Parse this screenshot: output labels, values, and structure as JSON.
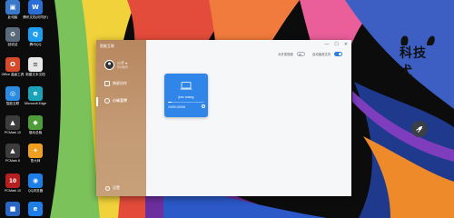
{
  "desktop": {
    "icons": [
      {
        "label": "此电脑",
        "glyph": "▣",
        "color": "#3a78c9"
      },
      {
        "label": "腾讯文档(可同步)",
        "glyph": "W",
        "color": "#2b6dd6"
      },
      {
        "label": "回收站",
        "glyph": "♻",
        "color": "#5a6a7a"
      },
      {
        "label": "腾讯QQ",
        "glyph": "Q",
        "color": "#1f9ef0"
      },
      {
        "label": "Office 高级工具",
        "glyph": "O",
        "color": "#d64a2c"
      },
      {
        "label": "新建文本文档",
        "glyph": "≡",
        "color": "#e8e8e8"
      },
      {
        "label": "智能互联",
        "glyph": "◎",
        "color": "#2a8be0"
      },
      {
        "label": "Microsoft Edge",
        "glyph": "e",
        "color": "#1aa2b8"
      },
      {
        "label": "PCMark 10",
        "glyph": "▲",
        "color": "#3c3c3c"
      },
      {
        "label": "驱动总裁",
        "glyph": "◆",
        "color": "#4f9d3a"
      },
      {
        "label": "PCMark 8",
        "glyph": "▲",
        "color": "#3c3c3c"
      },
      {
        "label": "鲁大师",
        "glyph": "✦",
        "color": "#f0a020"
      },
      {
        "label": "PCMark 10",
        "glyph": "10",
        "color": "#b51f1f"
      },
      {
        "label": "QQ浏览器",
        "glyph": "◉",
        "color": "#1c7ee6"
      },
      {
        "label": "",
        "glyph": "■",
        "color": "#2a66c4"
      },
      {
        "label": "",
        "glyph": "e",
        "color": "#1c7ee6"
      }
    ],
    "watermark_alt": "科技犬"
  },
  "app": {
    "title": "智能互联",
    "window_controls": [
      "—",
      "☐",
      "✕"
    ],
    "user": {
      "name": "小手 ▾",
      "sub": "华为账号"
    },
    "nav": [
      {
        "label": "跨屏协作",
        "icon": "screen-icon"
      },
      {
        "label": "小米互传",
        "icon": "share-icon",
        "active": true
      }
    ],
    "settings_label": "设置",
    "toggles": [
      {
        "label": "允许发现我",
        "on": false
      },
      {
        "label": "自动接收文件",
        "on": true
      }
    ],
    "device": {
      "name": "jian wang",
      "size": "20MB/180MB",
      "progress": 0.11,
      "color": "#2f86e8"
    }
  }
}
